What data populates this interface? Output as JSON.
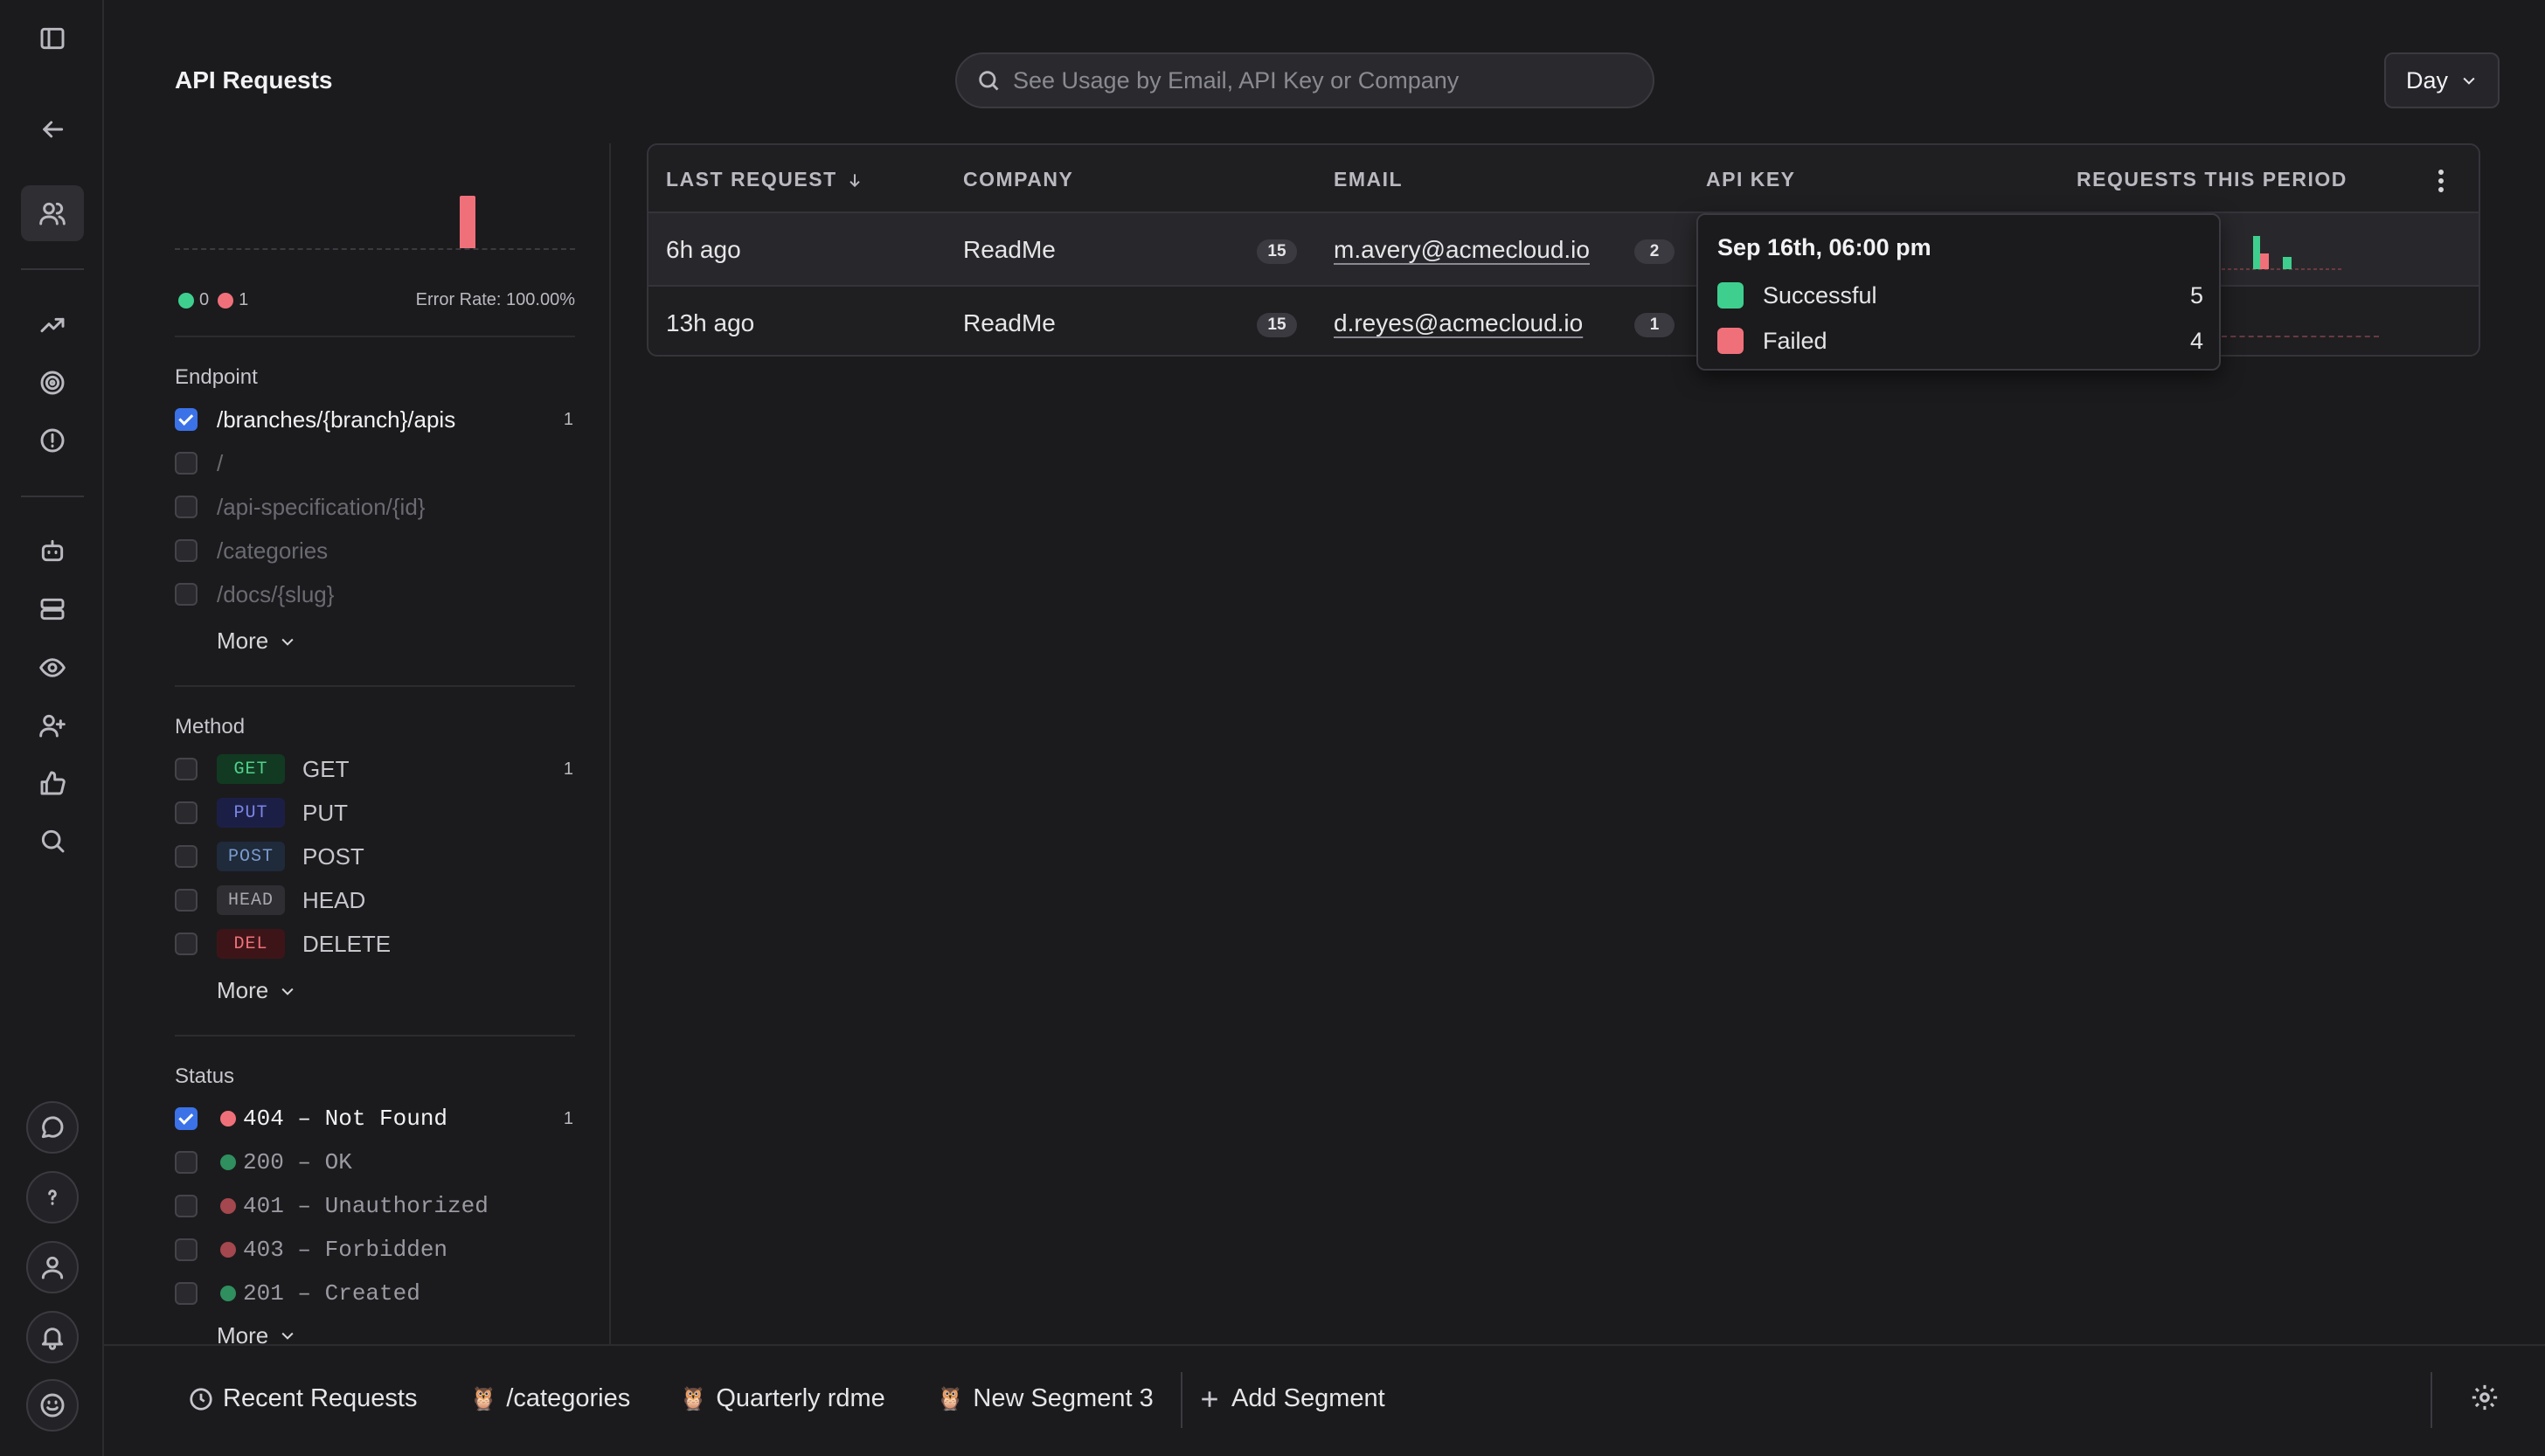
{
  "page": {
    "title": "API Requests"
  },
  "search": {
    "placeholder": "See Usage by Email, API Key or Company"
  },
  "period_select": {
    "value": "Day"
  },
  "summary": {
    "success_count": "0",
    "fail_count": "1",
    "error_rate": "Error Rate: 100.00%"
  },
  "filters": {
    "endpoint": {
      "title": "Endpoint",
      "items": [
        {
          "label": "/branches/{branch}/apis",
          "checked": true,
          "count": "1"
        },
        {
          "label": "/",
          "checked": false
        },
        {
          "label": "/api-specification/{id}",
          "checked": false
        },
        {
          "label": "/categories",
          "checked": false
        },
        {
          "label": "/docs/{slug}",
          "checked": false
        }
      ],
      "more": "More"
    },
    "method": {
      "title": "Method",
      "items": [
        {
          "badge": "GET",
          "label": "GET",
          "count": "1",
          "badge_bg": "#123a22",
          "badge_fg": "#4fd18b"
        },
        {
          "badge": "PUT",
          "label": "PUT",
          "badge_bg": "#1c1f45",
          "badge_fg": "#7a86e8"
        },
        {
          "badge": "POST",
          "label": "POST",
          "badge_bg": "#1f2a3a",
          "badge_fg": "#7a9bd0"
        },
        {
          "badge": "HEAD",
          "label": "HEAD",
          "badge_bg": "#2e2e33",
          "badge_fg": "#a8a8b0"
        },
        {
          "badge": "DEL",
          "label": "DELETE",
          "badge_bg": "#3d1518",
          "badge_fg": "#f0707a"
        }
      ],
      "more": "More"
    },
    "status": {
      "title": "Status",
      "items": [
        {
          "label": "404 – Not Found",
          "checked": true,
          "count": "1",
          "color": "#f0707a"
        },
        {
          "label": "200 – OK",
          "checked": false,
          "color": "#2f8f5e"
        },
        {
          "label": "401 – Unauthorized",
          "checked": false,
          "color": "#a4474e"
        },
        {
          "label": "403 – Forbidden",
          "checked": false,
          "color": "#a4474e"
        },
        {
          "label": "201 – Created",
          "checked": false,
          "color": "#2f8f5e"
        }
      ],
      "more": "More"
    }
  },
  "table": {
    "headers": {
      "last_request": "LAST REQUEST",
      "company": "COMPANY",
      "email": "EMAIL",
      "api_key": "API KEY",
      "requests": "REQUESTS THIS PERIOD"
    },
    "rows": [
      {
        "last_request": "6h ago",
        "company": "ReadMe",
        "company_count": "15",
        "email": "m.avery@acmecloud.io",
        "email_count": "2"
      },
      {
        "last_request": "13h ago",
        "company": "ReadMe",
        "company_count": "15",
        "email": "d.reyes@acmecloud.io",
        "email_count": "1"
      }
    ]
  },
  "tooltip": {
    "title": "Sep 16th, 06:00 pm",
    "rows": [
      {
        "label": "Successful",
        "value": "5",
        "color": "#3ecf8e"
      },
      {
        "label": "Failed",
        "value": "4",
        "color": "#f0707a"
      }
    ]
  },
  "segments": {
    "items": [
      {
        "label": "Recent Requests",
        "icon": "clock-icon"
      },
      {
        "label": "/categories",
        "icon": "owl-icon"
      },
      {
        "label": "Quarterly rdme",
        "icon": "owl-icon"
      },
      {
        "label": "New Segment 3",
        "icon": "owl-icon"
      }
    ],
    "add_label": "Add Segment"
  },
  "colors": {
    "success": "#3ecf8e",
    "failed": "#f0707a",
    "accent": "#3b72e8"
  }
}
